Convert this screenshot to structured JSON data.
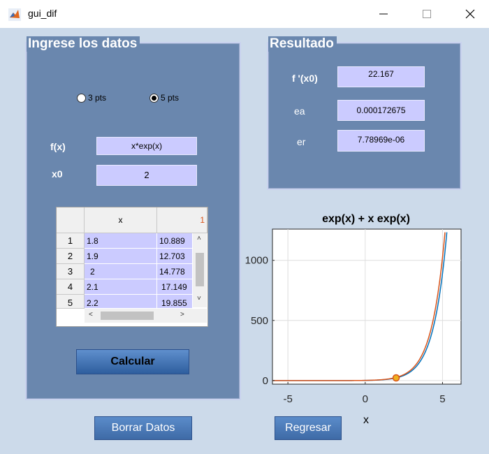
{
  "window": {
    "title": "gui_dif"
  },
  "input_panel": {
    "title": "Ingrese los datos",
    "radio_3": "3 pts",
    "radio_5": "5 pts",
    "selected": "5 pts",
    "fx_label": "f(x)",
    "fx_value": "x*exp(x)",
    "x0_label": "x0",
    "x0_value": "2"
  },
  "table": {
    "col_x": "x",
    "col_2": "1",
    "rows": [
      {
        "n": "1",
        "x": "1.8",
        "y": "10.889"
      },
      {
        "n": "2",
        "x": "1.9",
        "y": "12.703"
      },
      {
        "n": "3",
        "x": "2",
        "y": "14.778"
      },
      {
        "n": "4",
        "x": "2.1",
        "y": "17.149"
      },
      {
        "n": "5",
        "x": "2.2",
        "y": "19.855"
      }
    ]
  },
  "buttons": {
    "calcular": "Calcular",
    "borrar": "Borrar Datos",
    "regresar": "Regresar"
  },
  "result_panel": {
    "title": "Resultado",
    "fprime_label": "f '(x0)",
    "fprime_value": "22.167",
    "ea_label": "ea",
    "ea_value": "0.000172675",
    "er_label": "er",
    "er_value": "7.78969e-06"
  },
  "chart_data": {
    "type": "line",
    "title": "exp(x) + x exp(x)",
    "xlabel": "x",
    "ylabel": "",
    "xlim": [
      -6,
      6.2
    ],
    "ylim": [
      -30,
      1260
    ],
    "xticks": [
      -5,
      0,
      5
    ],
    "yticks": [
      0,
      500,
      1000
    ],
    "grid": true,
    "series": [
      {
        "function": "(1+x)*exp(x)",
        "color": "#0072bd"
      },
      {
        "function": "(1+x)*exp(x), shifted",
        "color": "#d95319"
      }
    ],
    "marker": {
      "x": 2,
      "y": 22.167,
      "color": "#d95319",
      "fill": "#edb120"
    }
  },
  "colors": {
    "panel": "#6a87ae",
    "background": "#ccdaea",
    "field": "#cbcbff"
  }
}
